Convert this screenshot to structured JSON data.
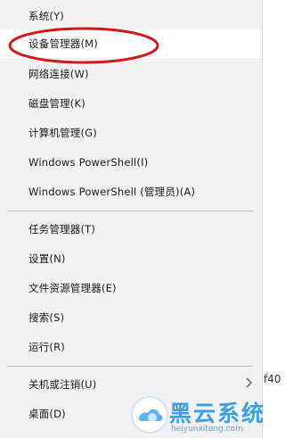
{
  "menu": {
    "items": [
      {
        "label": "系统(Y)"
      },
      {
        "label": "设备管理器(M)"
      },
      {
        "label": "网络连接(W)"
      },
      {
        "label": "磁盘管理(K)"
      },
      {
        "label": "计算机管理(G)"
      },
      {
        "label": "Windows PowerShell(I)"
      },
      {
        "label": "Windows PowerShell (管理员)(A)"
      },
      {
        "label": "任务管理器(T)"
      },
      {
        "label": "设置(N)"
      },
      {
        "label": "文件资源管理器(E)"
      },
      {
        "label": "搜索(S)"
      },
      {
        "label": "运行(R)"
      },
      {
        "label": "关机或注销(U)"
      },
      {
        "label": "桌面(D)"
      }
    ]
  },
  "background_partial_text": "f40",
  "watermark": {
    "title": "黑云系统",
    "subtitle": "heiyunxitong.com"
  },
  "colors": {
    "menu_bg": "#f2f2f2",
    "highlight": "#ffffff",
    "annotation_red": "#d11a1a",
    "watermark_blue": "#3aa0e6"
  },
  "icons": {
    "submenu": "chevron-right-icon",
    "watermark_logo": "cloud-logo-icon"
  }
}
